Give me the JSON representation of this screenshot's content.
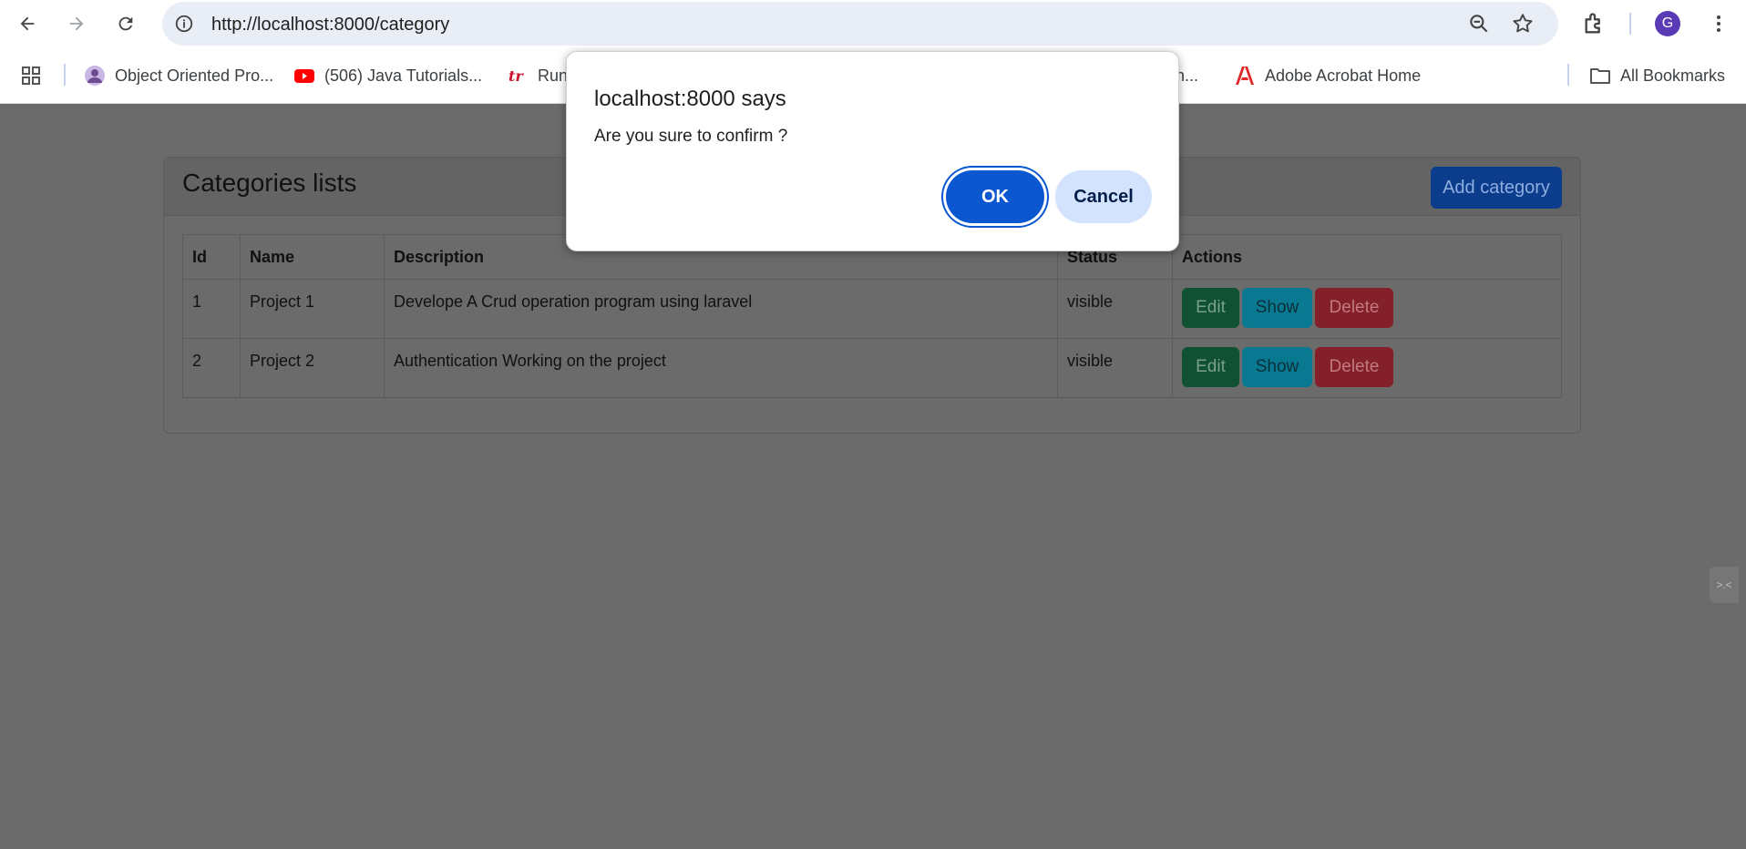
{
  "browser": {
    "url": "http://localhost:8000/category",
    "avatar_letter": "G",
    "bookmarks": [
      {
        "label": "Object Oriented Pro...",
        "icon": "profile-photo-icon"
      },
      {
        "label": "(506) Java Tutorials...",
        "icon": "youtube-icon"
      },
      {
        "label": "Run",
        "icon": "tr-logo-icon"
      },
      {
        "label": "n...",
        "icon": "truncated-bookmark"
      },
      {
        "label": "Adobe Acrobat Home",
        "icon": "adobe-acrobat-icon"
      }
    ],
    "all_bookmarks_label": "All Bookmarks"
  },
  "page": {
    "title": "Categories lists",
    "add_button": "Add category",
    "table": {
      "headers": [
        "Id",
        "Name",
        "Description",
        "Status",
        "Actions"
      ],
      "rows": [
        {
          "id": "1",
          "name": "Project 1",
          "description": "Develope A Crud operation program using laravel",
          "status": "visible"
        },
        {
          "id": "2",
          "name": "Project 2",
          "description": "Authentication Working on the project",
          "status": "visible"
        }
      ],
      "actions": {
        "edit": "Edit",
        "show": "Show",
        "delete": "Delete"
      }
    }
  },
  "dialog": {
    "title": "localhost:8000 says",
    "message": "Are you sure to confirm ?",
    "ok": "OK",
    "cancel": "Cancel"
  },
  "colors": {
    "overlay": "#6b6b6b",
    "ok_button": "#0b57d0",
    "cancel_button": "#d3e3fd",
    "edit_button": "#0f5132",
    "show_button": "#087990",
    "delete_button": "#842029",
    "add_button": "#0b3d8c"
  }
}
